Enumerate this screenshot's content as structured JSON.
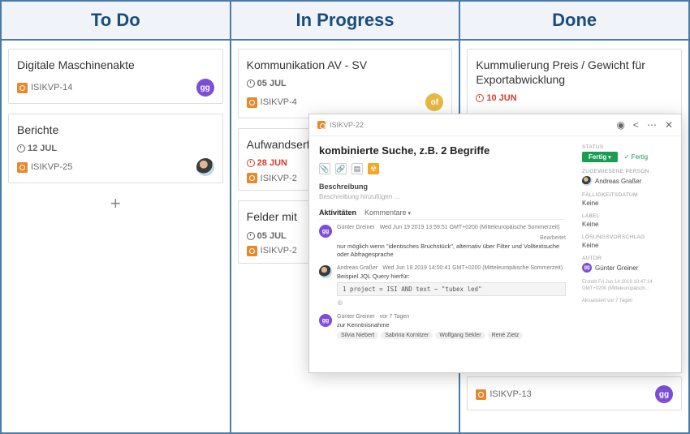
{
  "columns": [
    {
      "title": "To Do"
    },
    {
      "title": "In Progress"
    },
    {
      "title": "Done"
    }
  ],
  "todo": [
    {
      "title": "Digitale Maschinenakte",
      "key": "ISIKVP-14",
      "avatar": "gg"
    },
    {
      "title": "Berichte",
      "date": "12 JUL",
      "key": "ISIKVP-25",
      "avatar": "photo"
    }
  ],
  "inprogress": [
    {
      "title": "Kommunikation AV - SV",
      "date": "05 JUL",
      "key": "ISIKVP-4",
      "avatar": "of"
    },
    {
      "title": "Aufwandserfassung etc.",
      "date": "28 JUN",
      "overdue": true,
      "key": "ISIKVP-2"
    },
    {
      "title": "Felder mit",
      "date": "05 JUL",
      "key": "ISIKVP-2"
    }
  ],
  "done": [
    {
      "title": "Kummulierung Preis / Gewicht für Exportabwicklung",
      "date": "10 JUN",
      "overdue": true
    },
    {
      "title_hidden": "...",
      "key": "ISIKVP-13",
      "avatar": "gg"
    }
  ],
  "add_label": "+",
  "modal": {
    "breadcrumb": "ISIKVP-22",
    "title": "kombinierte Suche, z.B. 2 Begriffe",
    "desc_label": "Beschreibung",
    "desc_placeholder": "Beschreibung hinzufügen …",
    "tabs": {
      "activities": "Aktivitäten",
      "comments": "Kommentare"
    },
    "comments": [
      {
        "author": "Günter Greiner",
        "avatar": "gg",
        "time": "Wed Jun 19 2019 13:59:51 GMT+0200 (Mitteleuropäische Sommerzeit)",
        "edited": "Bearbeitet",
        "text": "nur möglich wenn \"identisches Bruchstück\", alternativ über Filter und Volltextsuche oder Abfragesprache"
      },
      {
        "author": "Andreas Graßer",
        "avatar": "photo",
        "time": "Wed Jun 19 2019 14:00:41 GMT+0200 (Mitteleuropäische Sommerzeit)",
        "text": "Beispiel JQL Query hierfür:",
        "code": "1   project = ISI AND text ~ \"tubex led\""
      },
      {
        "author": "Günter Greiner",
        "avatar": "gg",
        "time": "vor 7 Tagen",
        "text": "zur Kenntnisnahme",
        "mentions": [
          "Silvia Niebert",
          "Sabrina Kornitzer",
          "Wolfgang Sekler",
          "René Zietz"
        ]
      }
    ],
    "side": {
      "status_label": "STATUS",
      "status_value": "Fertig",
      "status_done": "✓ Fertig",
      "assignee_label": "ZUGEWIESENE PERSON",
      "assignee_value": "Andreas Graßer",
      "due_label": "FÄLLIGKEITSDATUM",
      "due_value": "Keine",
      "label_label": "LABEL",
      "label_value": "Keine",
      "solution_label": "LÖSUNGSVORSCHLAG",
      "solution_value": "Keine",
      "author_label": "AUTOR",
      "author_value": "Günter Greiner",
      "created": "Erstellt Fri Jun 14 2019 10:47:14 GMT+0200 (Mitteleuropäisch…",
      "updated": "Aktualisiert vor 7 Tagen"
    }
  }
}
